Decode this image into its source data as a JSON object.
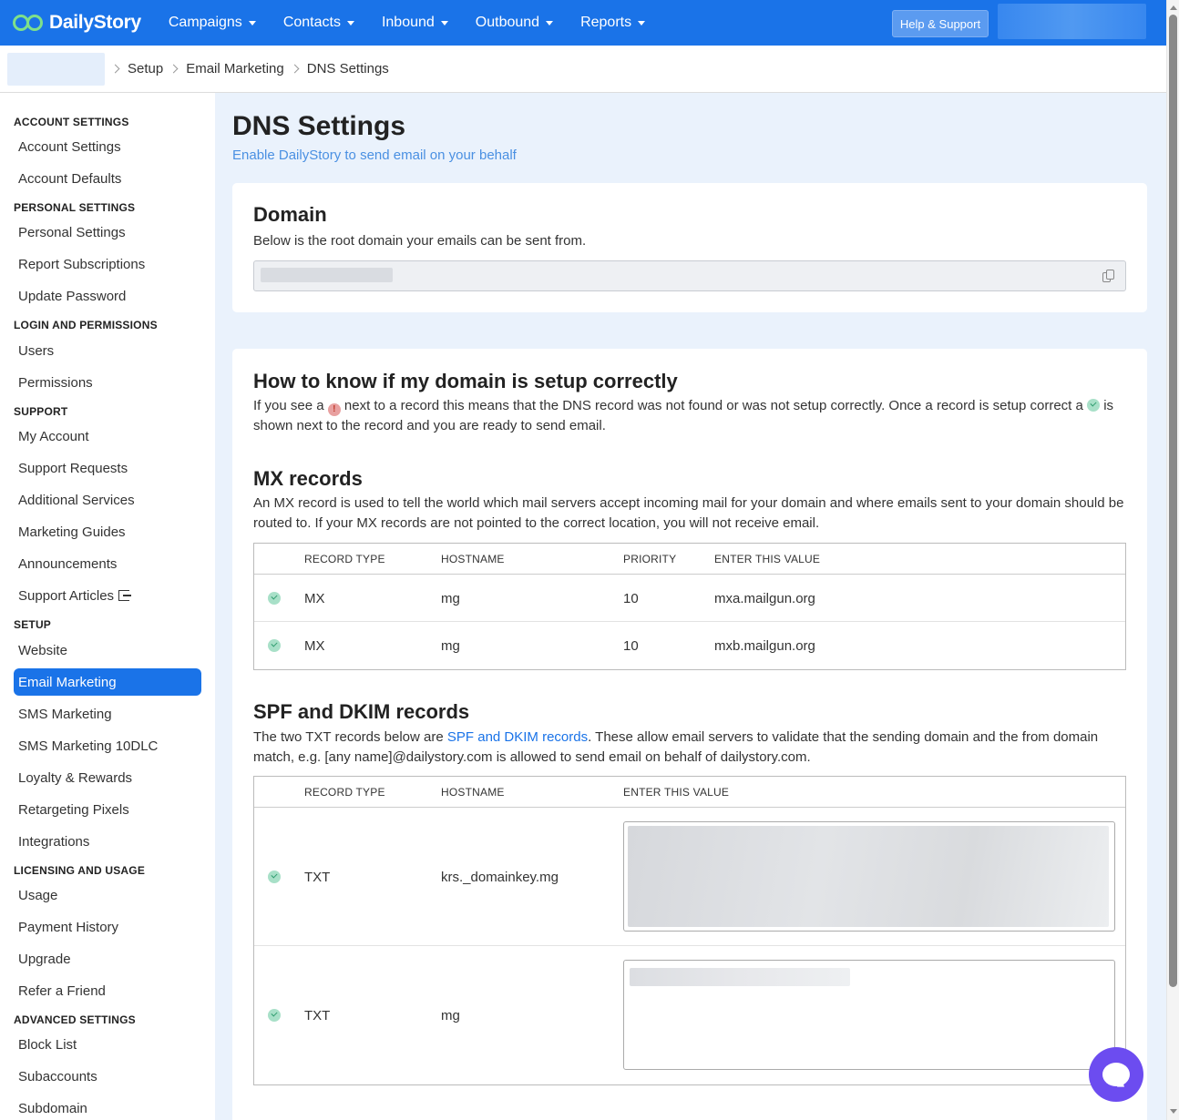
{
  "app": {
    "brand": "DailyStory"
  },
  "nav": {
    "items": [
      "Campaigns",
      "Contacts",
      "Inbound",
      "Outbound",
      "Reports"
    ],
    "help_label": "Help & Support"
  },
  "breadcrumb": [
    "Setup",
    "Email Marketing",
    "DNS Settings"
  ],
  "sidebar": {
    "sections": [
      {
        "title": "ACCOUNT SETTINGS",
        "items": [
          "Account Settings",
          "Account Defaults"
        ]
      },
      {
        "title": "PERSONAL SETTINGS",
        "items": [
          "Personal Settings",
          "Report Subscriptions",
          "Update Password"
        ]
      },
      {
        "title": "LOGIN AND PERMISSIONS",
        "items": [
          "Users",
          "Permissions"
        ]
      },
      {
        "title": "SUPPORT",
        "items": [
          "My Account",
          "Support Requests",
          "Additional Services",
          "Marketing Guides",
          "Announcements",
          "Support Articles"
        ]
      },
      {
        "title": "SETUP",
        "items": [
          "Website",
          "Email Marketing",
          "SMS Marketing",
          "SMS Marketing 10DLC",
          "Loyalty & Rewards",
          "Retargeting Pixels",
          "Integrations"
        ]
      },
      {
        "title": "LICENSING AND USAGE",
        "items": [
          "Usage",
          "Payment History",
          "Upgrade",
          "Refer a Friend"
        ]
      },
      {
        "title": "ADVANCED SETTINGS",
        "items": [
          "Block List",
          "Subaccounts",
          "Subdomain"
        ]
      }
    ],
    "active_item": "Email Marketing"
  },
  "page": {
    "title": "DNS Settings",
    "subtitle": "Enable DailyStory to send email on your behalf"
  },
  "domain_card": {
    "title": "Domain",
    "description": "Below is the root domain your emails can be sent from."
  },
  "howto": {
    "title": "How to know if my domain is setup correctly",
    "text_1": "If you see a",
    "text_2": "next to a record this means that the DNS record was not found or was not setup correctly. Once a record is setup correct a",
    "text_3": "is shown next to the record and you are ready to send email.",
    "error_glyph": "!"
  },
  "mx": {
    "title": "MX records",
    "description": "An MX record is used to tell the world which mail servers accept incoming mail for your domain and where emails sent to your domain should be routed to. If your MX records are not pointed to the correct location, you will not receive email.",
    "headers": [
      "RECORD TYPE",
      "HOSTNAME",
      "PRIORITY",
      "ENTER THIS VALUE"
    ],
    "rows": [
      {
        "type": "MX",
        "hostname": "mg",
        "priority": "10",
        "value": "mxa.mailgun.org"
      },
      {
        "type": "MX",
        "hostname": "mg",
        "priority": "10",
        "value": "mxb.mailgun.org"
      }
    ]
  },
  "spf": {
    "title": "SPF and DKIM records",
    "desc_1": "The two TXT records below are",
    "desc_link": "SPF and DKIM records",
    "desc_2": ". These allow email servers to validate that the sending domain and the from domain match, e.g. [any name]@dailystory.com is allowed to send email on behalf of dailystory.com.",
    "headers": [
      "RECORD TYPE",
      "HOSTNAME",
      "ENTER THIS VALUE"
    ],
    "rows": [
      {
        "type": "TXT",
        "hostname": "krs._domainkey.mg"
      },
      {
        "type": "TXT",
        "hostname": "mg"
      }
    ]
  },
  "colors": {
    "primary": "#1a73e8",
    "success": "#a8e0c8",
    "error": "#e8a0a0",
    "chat": "#6c4cf0"
  }
}
